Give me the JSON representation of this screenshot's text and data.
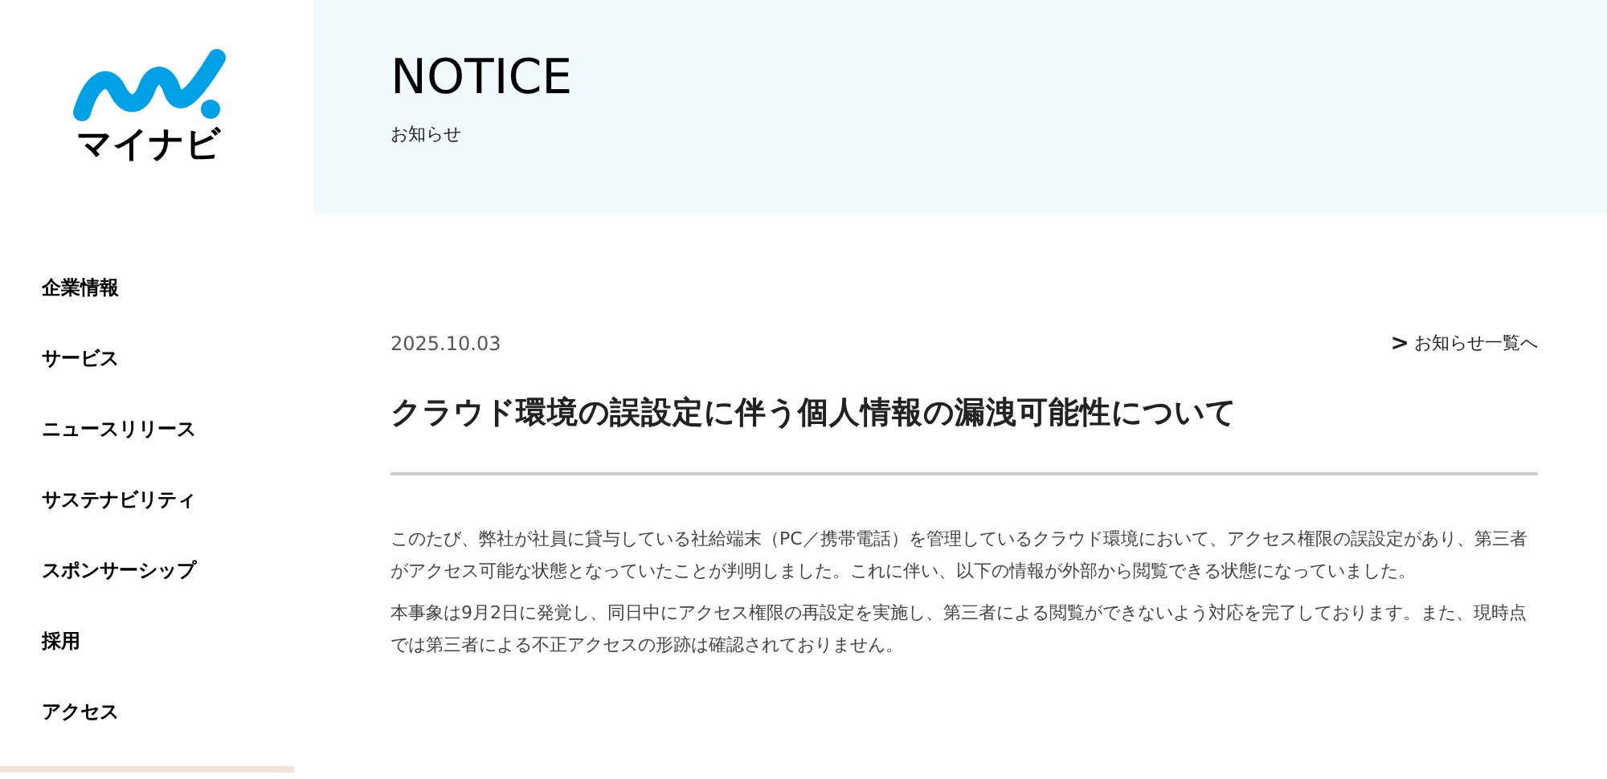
{
  "logo": {
    "text": "マイナビ"
  },
  "header": {
    "title": "NOTICE",
    "subtitle": "お知らせ"
  },
  "sidebar": {
    "items": [
      {
        "label": "企業情報"
      },
      {
        "label": "サービス"
      },
      {
        "label": "ニュースリリース"
      },
      {
        "label": "サステナビリティ"
      },
      {
        "label": "スポンサーシップ"
      },
      {
        "label": "採用"
      },
      {
        "label": "アクセス"
      }
    ]
  },
  "article": {
    "date": "2025.10.03",
    "back_link": {
      "icon": ">",
      "label": "お知らせ一覧へ"
    },
    "title": "クラウド環境の誤設定に伴う個人情報の漏洩可能性について",
    "paragraphs": [
      "このたび、弊社が社員に貸与している社給端末（PC／携帯電話）を管理しているクラウド環境において、アクセス権限の誤設定があり、第三者がアクセス可能な状態となっていたことが判明しました。これに伴い、以下の情報が外部から閲覧できる状態になっていました。",
      "本事象は9月2日に発覚し、同日中にアクセス権限の再設定を実施し、第三者による閲覧ができないよう対応を完了しております。また、現時点では第三者による不正アクセスの形跡は確認されておりません。"
    ]
  }
}
